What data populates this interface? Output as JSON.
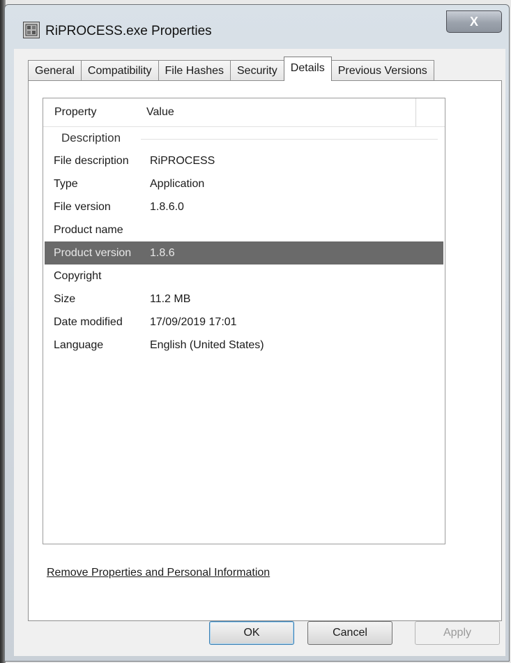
{
  "window": {
    "title": "RiPROCESS.exe Properties",
    "close_label": "X"
  },
  "tabs": [
    {
      "label": "General"
    },
    {
      "label": "Compatibility"
    },
    {
      "label": "File Hashes"
    },
    {
      "label": "Security"
    },
    {
      "label": "Details",
      "active": true
    },
    {
      "label": "Previous Versions"
    }
  ],
  "details": {
    "header": {
      "property": "Property",
      "value": "Value"
    },
    "group_label": "Description",
    "rows": [
      {
        "property": "File description",
        "value": "RiPROCESS"
      },
      {
        "property": "Type",
        "value": "Application"
      },
      {
        "property": "File version",
        "value": "1.8.6.0"
      },
      {
        "property": "Product name",
        "value": ""
      },
      {
        "property": "Product version",
        "value": "1.8.6",
        "selected": true
      },
      {
        "property": "Copyright",
        "value": ""
      },
      {
        "property": "Size",
        "value": "11.2 MB"
      },
      {
        "property": "Date modified",
        "value": "17/09/2019 17:01"
      },
      {
        "property": "Language",
        "value": "English (United States)"
      }
    ],
    "remove_link": "Remove Properties and Personal Information"
  },
  "buttons": {
    "ok": "OK",
    "cancel": "Cancel",
    "apply": "Apply"
  },
  "colors": {
    "selection": "#6a6a6a",
    "ok_focus": "#3c7fb1"
  }
}
